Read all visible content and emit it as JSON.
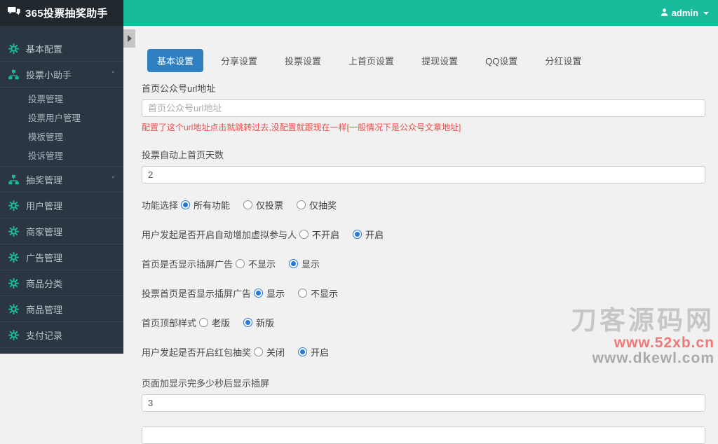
{
  "app": {
    "title": "365投票抽奖助手",
    "user": "admin"
  },
  "colors": {
    "topbar_green": "#18bc9c",
    "sidebar_dark": "#2b3642",
    "active_tab_blue": "#2e80c3",
    "icon_green": "#1abc9c",
    "hint_red": "#ef4c4c"
  },
  "sidebar": {
    "items": [
      {
        "label": "基本配置",
        "icon": "gear-icon"
      },
      {
        "label": "投票小助手",
        "icon": "sitemap-icon",
        "state": "expanded",
        "children": [
          "投票管理",
          "投票用户管理",
          "模板管理",
          "投诉管理"
        ]
      },
      {
        "label": "抽奖管理",
        "icon": "sitemap-icon",
        "state": "collapsed"
      },
      {
        "label": "用户管理",
        "icon": "gear-icon"
      },
      {
        "label": "商家管理",
        "icon": "gear-icon"
      },
      {
        "label": "广告管理",
        "icon": "gear-icon"
      },
      {
        "label": "商品分类",
        "icon": "gear-icon"
      },
      {
        "label": "商品管理",
        "icon": "gear-icon"
      },
      {
        "label": "支付记录",
        "icon": "gear-icon"
      }
    ]
  },
  "tabs": {
    "active_index": 0,
    "items": [
      "基本设置",
      "分享设置",
      "投票设置",
      "上首页设置",
      "提现设置",
      "QQ设置",
      "分红设置"
    ]
  },
  "form": {
    "url_field": {
      "label": "首页公众号url地址",
      "placeholder": "首页公众号url地址",
      "hint": "配置了这个url地址点击就跳转过去,没配置就跟现在一样[一般情况下是公众号文章地址]"
    },
    "days_field": {
      "label": "投票自动上首页天数",
      "value": "2"
    },
    "radio_rows": [
      {
        "label": "功能选择",
        "options": [
          "所有功能",
          "仅投票",
          "仅抽奖"
        ],
        "selected": 0
      },
      {
        "label": "用户发起是否开启自动增加虚拟参与人",
        "options": [
          "不开启",
          "开启"
        ],
        "selected": 1
      },
      {
        "label": "首页是否显示插屏广告",
        "options": [
          "不显示",
          "显示"
        ],
        "selected": 1
      },
      {
        "label": "投票首页是否显示插屏广告",
        "options": [
          "显示",
          "不显示"
        ],
        "selected": 0
      },
      {
        "label": "首页顶部样式",
        "options": [
          "老版",
          "新版"
        ],
        "selected": 1
      },
      {
        "label": "用户发起是否开启红包抽奖",
        "options": [
          "关闭",
          "开启"
        ],
        "selected": 1
      }
    ],
    "delay_field": {
      "label": "页面加显示完多少秒后显示插屏",
      "value": "3"
    }
  },
  "watermark": {
    "line1": "刀客源码网",
    "line2": "www.52xb.cn",
    "line3": "www.dkewl.com"
  }
}
